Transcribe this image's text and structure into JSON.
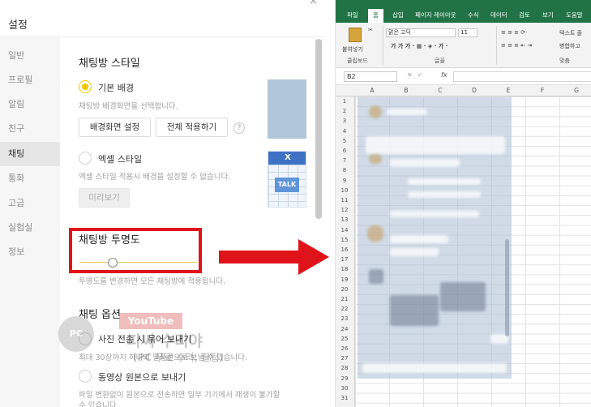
{
  "settings": {
    "title": "설정",
    "close_icon": "×",
    "sidebar": [
      {
        "label": "일반"
      },
      {
        "label": "프로필"
      },
      {
        "label": "알림"
      },
      {
        "label": "친구"
      },
      {
        "label": "채팅",
        "active": true
      },
      {
        "label": "통화"
      },
      {
        "label": "고급"
      },
      {
        "label": "실험실"
      },
      {
        "label": "정보"
      }
    ],
    "chat_style": {
      "heading": "채팅방 스타일",
      "basic": {
        "label": "기본 배경",
        "selected": true,
        "desc": "채팅방 배경화면을 선택합니다.",
        "btn_bg": "배경화면 설정",
        "btn_apply_all": "전체 적용하기",
        "help_icon": "?"
      },
      "excel": {
        "label": "엑셀 스타일",
        "selected": false,
        "desc": "엑셀 스타일 적용시 배경을 설정할 수 없습니다.",
        "btn_preview": "미리보기",
        "preview_x": "X",
        "preview_talk": "TALK"
      }
    },
    "transparency": {
      "heading": "채팅방 투명도",
      "desc": "투명도를 변경하면 모든 채팅방에 적용됩니다.",
      "value_fraction": 0.28
    },
    "chat_options": {
      "heading": "채팅 옵션",
      "photo_bundle": "사진 전송 시 묶어 보내기",
      "photo_bundle_desc": "최대 30장까지 하나의 말풍선으로 보낼 수 있습니다.",
      "video_original": "동영상 원본으로 보내기",
      "video_desc_1": "파일 변환없이 원본으로 전송하면 일부 기기에서 재생이 불가할",
      "video_desc_2": "수 있습니다."
    },
    "watermark": {
      "badge": "PC",
      "youtube": "YouTube",
      "line1": "피씨 수리야",
      "line2": "(PC 무료 수리, 꿀팁)"
    }
  },
  "excel": {
    "tabs": [
      "파일",
      "홈",
      "삽입",
      "페이지 레이아웃",
      "수식",
      "데이터",
      "검토",
      "보기",
      "도움말"
    ],
    "active_tab": "홈",
    "ribbon": {
      "paste_label": "붙여넣기",
      "clipboard_group": "클립보드",
      "font_name": "맑은 고딕",
      "font_size": "11",
      "font_group": "글꼴",
      "align_group": "맞춤",
      "wrap_text": "텍스트 줄",
      "merge_center": "병합하고"
    },
    "name_box": "B2",
    "formula_fx": "fx",
    "columns": [
      "A",
      "B",
      "C",
      "D",
      "E",
      "F",
      "G"
    ],
    "rows": [
      "1",
      "2",
      "3",
      "4",
      "5",
      "6",
      "7",
      "8",
      "9",
      "10",
      "11",
      "12",
      "13",
      "14",
      "15",
      "16",
      "17",
      "18",
      "19",
      "20",
      "21",
      "22",
      "23",
      "24",
      "25",
      "26",
      "27",
      "28",
      "29",
      "30",
      "31"
    ]
  },
  "colors": {
    "kakao_yellow": "#f5c400",
    "excel_green": "#217346",
    "highlight_red": "#e0131a"
  }
}
